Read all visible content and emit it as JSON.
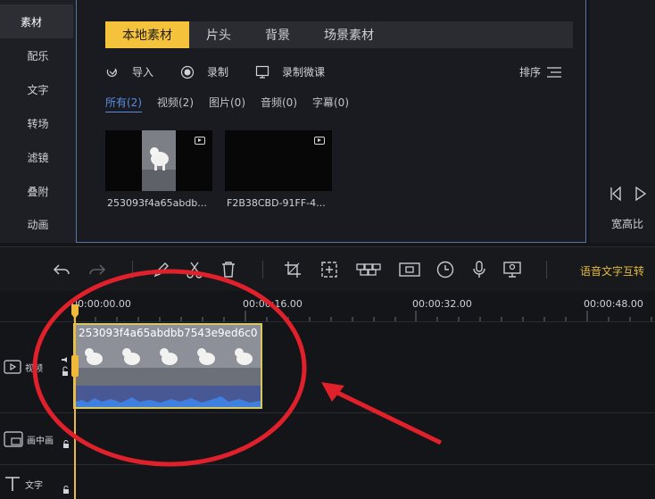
{
  "nav": {
    "items": [
      {
        "label": "素材",
        "active": true
      },
      {
        "label": "配乐"
      },
      {
        "label": "文字"
      },
      {
        "label": "转场"
      },
      {
        "label": "滤镜"
      },
      {
        "label": "叠附"
      },
      {
        "label": "动画"
      }
    ]
  },
  "media": {
    "tabs": [
      {
        "label": "本地素材",
        "active": true
      },
      {
        "label": "片头"
      },
      {
        "label": "背景"
      },
      {
        "label": "场景素材"
      }
    ],
    "tools": {
      "import": "导入",
      "record": "录制",
      "record_micro": "录制微课",
      "sort": "排序"
    },
    "filters": [
      {
        "label": "所有(2)",
        "active": true
      },
      {
        "label": "视频(2)"
      },
      {
        "label": "图片(0)"
      },
      {
        "label": "音频(0)"
      },
      {
        "label": "字幕(0)"
      }
    ],
    "files": [
      {
        "name": "253093f4a65abdb..."
      },
      {
        "name": "F2B38CBD-91FF-4..."
      }
    ]
  },
  "preview": {
    "aspect_label": "宽高比"
  },
  "toolbar": {
    "speech_to_text": "语音文字互转"
  },
  "timeline": {
    "times": [
      "00:00:00.00",
      "00:00:16.00",
      "00:00:32.00",
      "00:00:48.00"
    ],
    "tracks": [
      {
        "label": "视频"
      },
      {
        "label": "画中画"
      },
      {
        "label": "文字"
      }
    ],
    "clip": {
      "name": "253093f4a65abdbb7543e9ed6c0"
    }
  },
  "colors": {
    "accent": "#f5c33b",
    "link": "#5b8be0",
    "annotation": "#e0202a"
  }
}
